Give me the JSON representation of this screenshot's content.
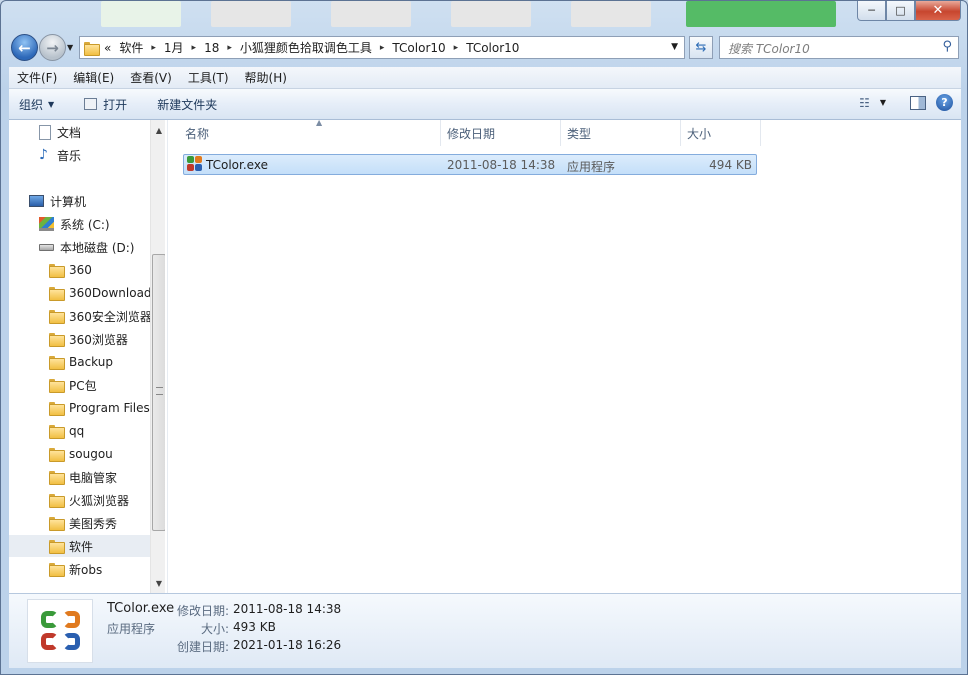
{
  "window": {
    "buttons": {
      "minimize": "─",
      "maximize": "□",
      "close": "✕"
    }
  },
  "nav": {
    "address_overflow": "«",
    "breadcrumbs": [
      "软件",
      "1月",
      "18",
      "小狐狸颜色拾取调色工具",
      "TColor10",
      "TColor10"
    ],
    "search_placeholder": "搜索 TColor10"
  },
  "menu": [
    "文件(F)",
    "编辑(E)",
    "查看(V)",
    "工具(T)",
    "帮助(H)"
  ],
  "toolbar": {
    "organize": "组织",
    "open": "打开",
    "new_folder": "新建文件夹"
  },
  "sidebar": {
    "items": [
      {
        "label": "文档",
        "icon": "document-icon",
        "indent": 1
      },
      {
        "label": "音乐",
        "icon": "music-icon",
        "indent": 1
      },
      {
        "label": "计算机",
        "icon": "computer-icon",
        "indent": 0
      },
      {
        "label": "系统 (C:)",
        "icon": "system-drive-icon",
        "indent": 1
      },
      {
        "label": "本地磁盘 (D:)",
        "icon": "drive-icon",
        "indent": 1
      },
      {
        "label": "360",
        "icon": "folder-icon",
        "indent": 2
      },
      {
        "label": "360Download",
        "icon": "folder-icon",
        "indent": 2
      },
      {
        "label": "360安全浏览器",
        "icon": "folder-icon",
        "indent": 2
      },
      {
        "label": "360浏览器",
        "icon": "folder-icon",
        "indent": 2
      },
      {
        "label": "Backup",
        "icon": "folder-icon",
        "indent": 2
      },
      {
        "label": "PC包",
        "icon": "folder-icon",
        "indent": 2
      },
      {
        "label": "Program Files",
        "icon": "folder-icon",
        "indent": 2
      },
      {
        "label": "qq",
        "icon": "folder-icon",
        "indent": 2
      },
      {
        "label": "sougou",
        "icon": "folder-icon",
        "indent": 2
      },
      {
        "label": "电脑管家",
        "icon": "folder-icon",
        "indent": 2
      },
      {
        "label": "火狐浏览器",
        "icon": "folder-icon",
        "indent": 2
      },
      {
        "label": "美图秀秀",
        "icon": "folder-icon",
        "indent": 2
      },
      {
        "label": "软件",
        "icon": "folder-icon",
        "indent": 2,
        "selected": true
      },
      {
        "label": "新obs",
        "icon": "folder-icon",
        "indent": 2
      }
    ]
  },
  "columns": {
    "name": "名称",
    "modified": "修改日期",
    "type": "类型",
    "size": "大小"
  },
  "files": [
    {
      "name": "TColor.exe",
      "modified": "2011-08-18 14:38",
      "type": "应用程序",
      "size": "494 KB"
    }
  ],
  "details": {
    "filename": "TColor.exe",
    "filetype": "应用程序",
    "modified_label": "修改日期:",
    "modified_value": "2011-08-18 14:38",
    "size_label": "大小:",
    "size_value": "493 KB",
    "created_label": "创建日期:",
    "created_value": "2021-01-18 16:26"
  },
  "colors": {
    "selection": "#c4dff9",
    "accent": "#2d68b8",
    "icon_green": "#3a9a3a",
    "icon_orange": "#e07a1f",
    "icon_red": "#c0392b",
    "icon_blue": "#2a5fb0"
  }
}
